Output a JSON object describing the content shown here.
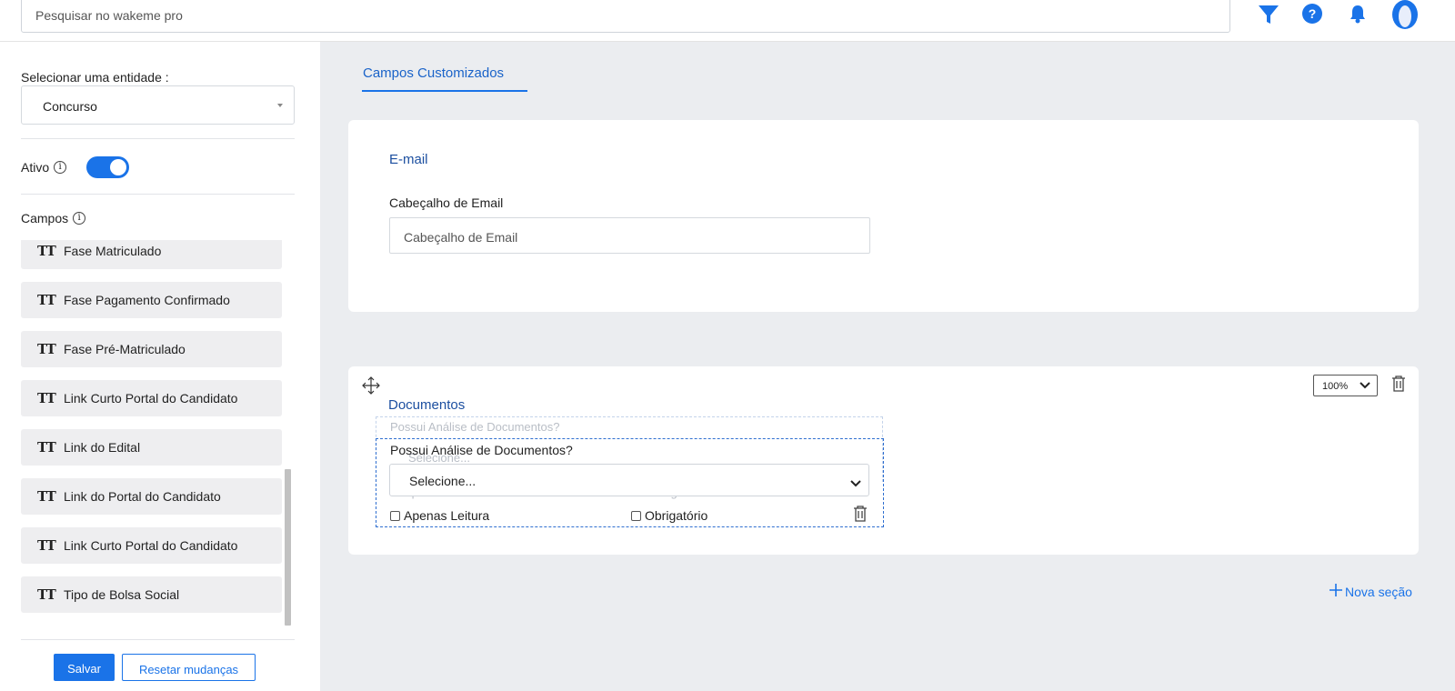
{
  "topbar": {
    "search_placeholder": "Pesquisar no wakeme pro"
  },
  "sidebar": {
    "entity_label": "Selecionar uma entidade :",
    "entity_value": "Concurso",
    "active_label": "Ativo",
    "active_on": true,
    "fields_label": "Campos",
    "fields": [
      "Fase Matriculado",
      "Fase Pagamento Confirmado",
      "Fase Pré-Matriculado",
      "Link Curto Portal do Candidato",
      "Link do Edital",
      "Link do Portal do Candidato",
      "Link Curto Portal do Candidato",
      "Tipo de Bolsa Social"
    ],
    "field_icon_text": "TT",
    "save_label": "Salvar",
    "reset_label": "Resetar mudanças"
  },
  "main": {
    "tab_label": "Campos Customizados",
    "email_section": {
      "title": "E-mail",
      "field_label": "Cabeçalho de Email",
      "field_placeholder": "Cabeçalho de Email"
    },
    "docs_section": {
      "title": "Documentos",
      "zoom_value": "100%",
      "ghost_question": "Possui Análise de Documentos?",
      "ghost_select": "Selecione...",
      "ghost_readonly": "Apenas Leitura",
      "ghost_required": "Obrigatório",
      "question": "Possui Análise de Documentos?",
      "select_value": "Selecione...",
      "readonly_label": "Apenas Leitura",
      "required_label": "Obrigatório"
    },
    "new_section_label": "Nova seção"
  },
  "colors": {
    "accent": "#1a73e8",
    "background": "#ebedf0"
  }
}
